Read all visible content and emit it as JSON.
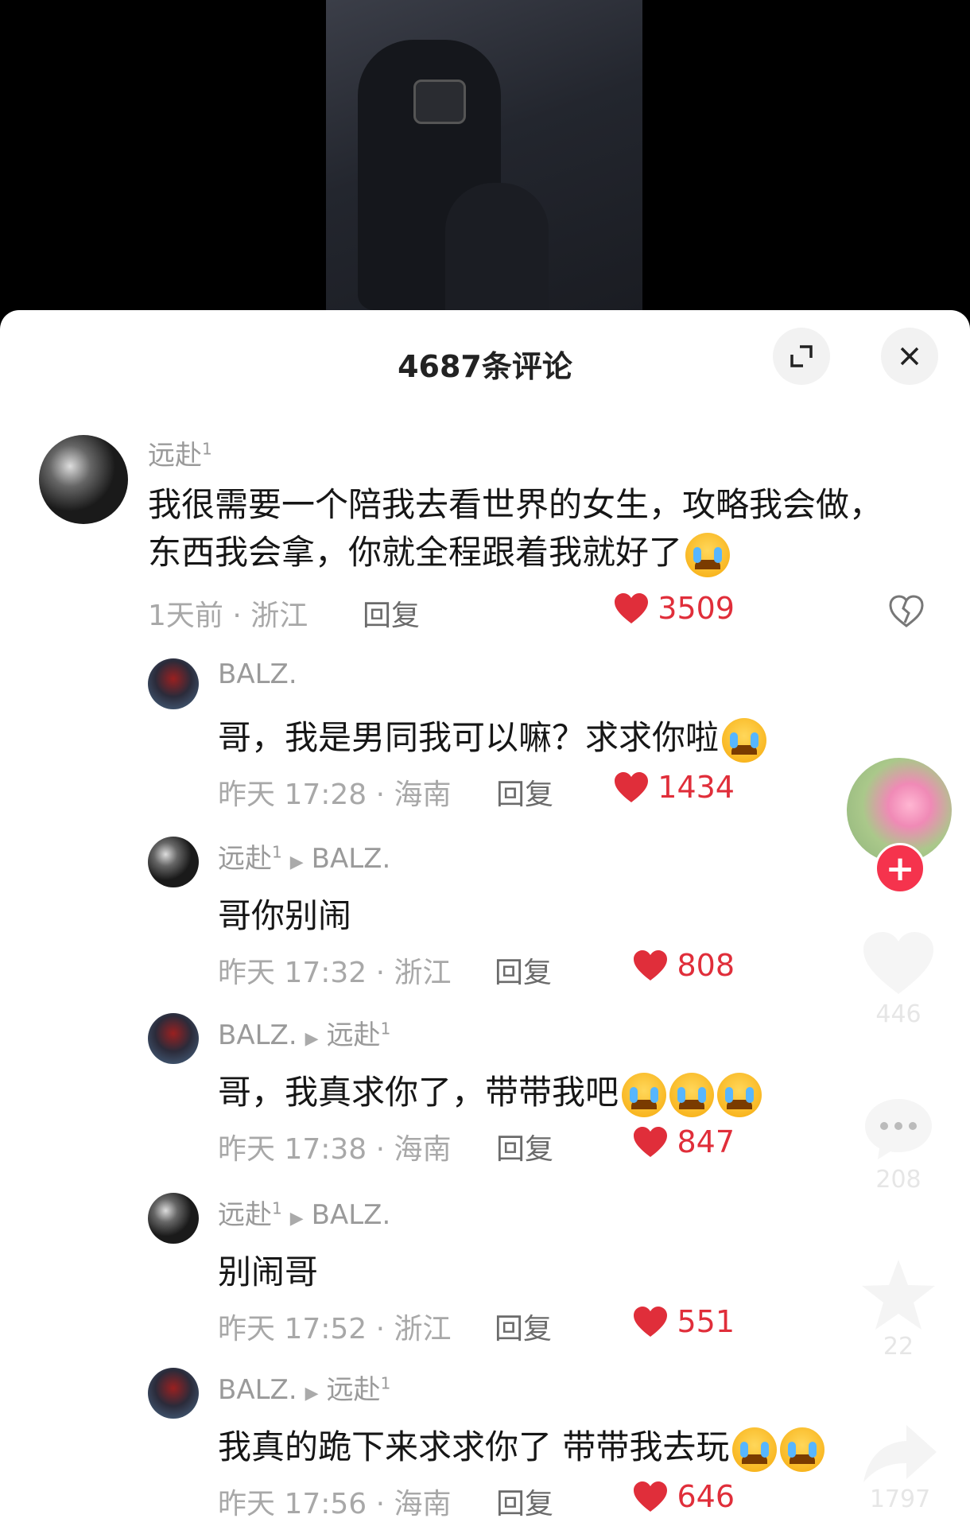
{
  "header": {
    "title": "4687条评论"
  },
  "comments": [
    {
      "author": "远赴",
      "author_sup": "1",
      "text": "我很需要一个陪我去看世界的女生，攻略我会做，东西我会拿，你就全程跟着我就好了",
      "meta": "1天前 · 浙江",
      "reply": "回复",
      "likes": "3509"
    }
  ],
  "replies": [
    {
      "author": "BALZ.",
      "reply_to": "",
      "reply_to_sup": "",
      "author_sup": "",
      "text": "哥，我是男同我可以嘛？求求你啦",
      "meta": "昨天 17:28 · 海南",
      "reply": "回复",
      "likes": "1434"
    },
    {
      "author": "远赴",
      "author_sup": "1",
      "reply_to": "BALZ.",
      "reply_to_sup": "",
      "text": "哥你别闹",
      "meta": "昨天 17:32 · 浙江",
      "reply": "回复",
      "likes": "808"
    },
    {
      "author": "BALZ.",
      "author_sup": "",
      "reply_to": "远赴",
      "reply_to_sup": "1",
      "text": "哥，我真求你了，带带我吧",
      "meta": "昨天 17:38 · 海南",
      "reply": "回复",
      "likes": "847"
    },
    {
      "author": "远赴",
      "author_sup": "1",
      "reply_to": "BALZ.",
      "reply_to_sup": "",
      "text": "别闹哥",
      "meta": "昨天 17:52 · 浙江",
      "reply": "回复",
      "likes": "551"
    },
    {
      "author": "BALZ.",
      "author_sup": "",
      "reply_to": "远赴",
      "reply_to_sup": "1",
      "text": "我真的跪下来求求你了 带带我去玩",
      "meta": "昨天 17:56 · 海南",
      "reply": "回复",
      "likes": "646"
    }
  ],
  "sidebar": {
    "like_count": "446",
    "comment_count": "208",
    "favorite_count": "22",
    "share_count": "1797",
    "follow_symbol": "+"
  },
  "colors": {
    "accent": "#e02e3a",
    "follow": "#f5334d"
  }
}
